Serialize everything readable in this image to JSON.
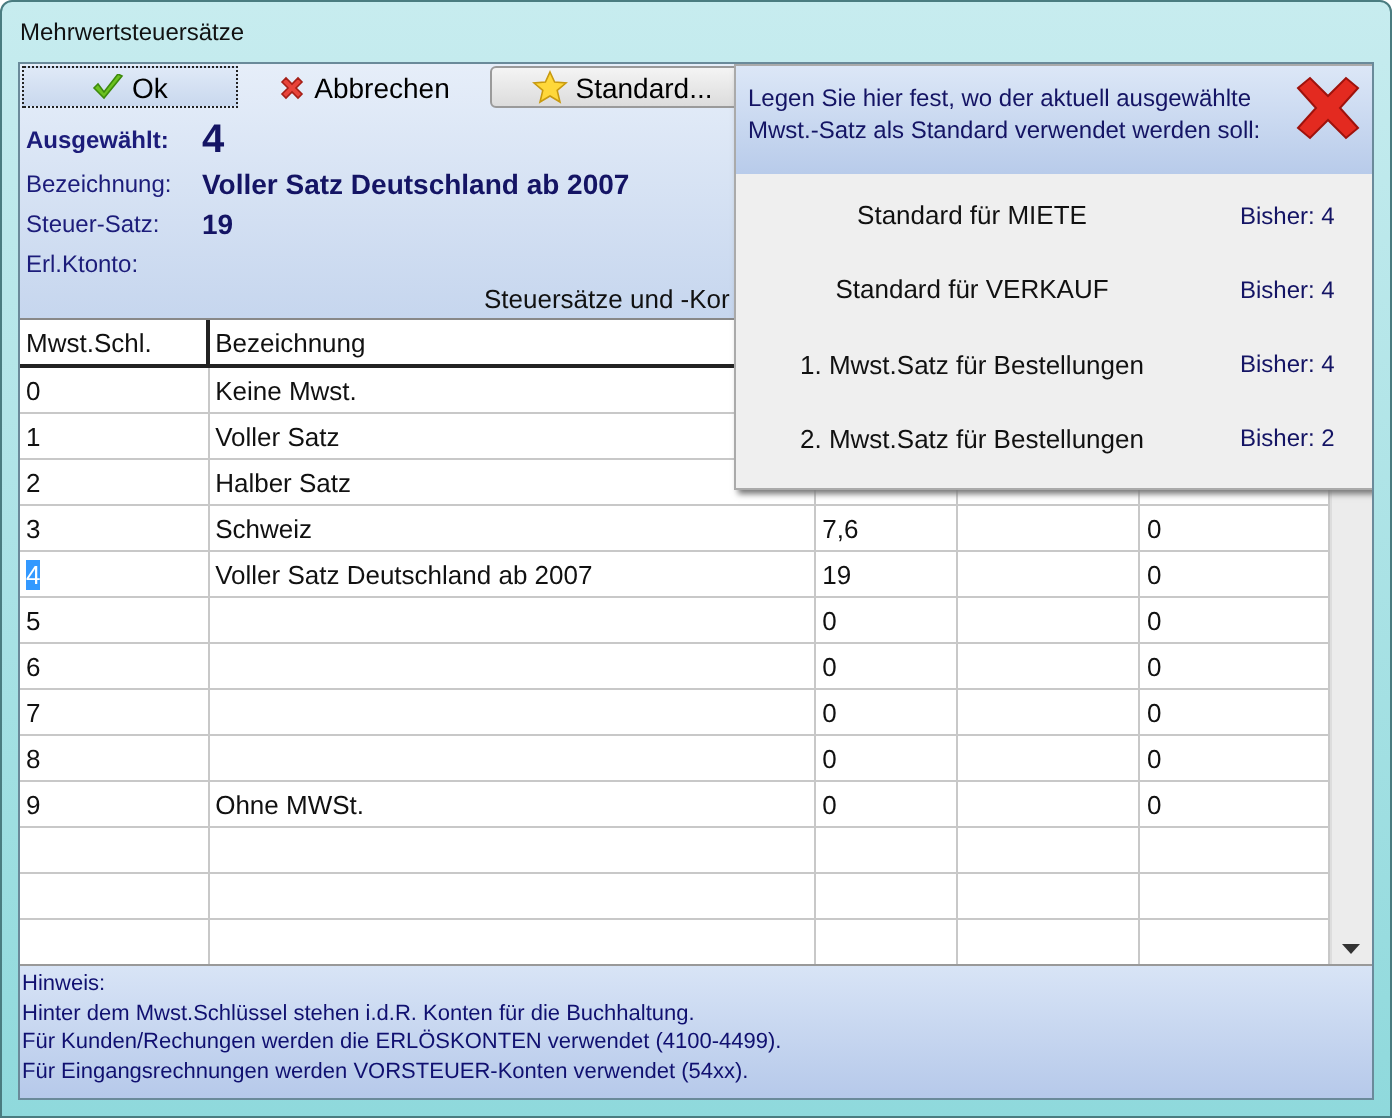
{
  "window": {
    "title": "Mehrwertsteuersätze"
  },
  "toolbar": [
    {
      "kind": "ok",
      "label": "Ok",
      "focused": true
    },
    {
      "kind": "cancel",
      "label": "Abbrechen",
      "focused": false
    },
    {
      "kind": "star",
      "label": "Standard...",
      "focused": false
    }
  ],
  "details": [
    {
      "label": "Ausgewählt:",
      "value": "4",
      "kind": "big"
    },
    {
      "label": "Bezeichnung:",
      "value": "Voller Satz Deutschland ab 2007",
      "kind": "normal"
    },
    {
      "label": "Steuer-Satz:",
      "value": "19",
      "kind": "normal"
    },
    {
      "label": "Erl.Ktonto:",
      "kind": "normal"
    }
  ],
  "table_caption": "Steuersätze und -Kor",
  "table": {
    "columns": [
      "Mwst.Schl.",
      "Bezeichnung"
    ],
    "rows": [
      {
        "cells": [
          "0",
          "Keine Mwst."
        ],
        "selected": false
      },
      {
        "cells": [
          "1",
          "Voller Satz"
        ],
        "selected": false
      },
      {
        "cells": [
          "2",
          "Halber Satz"
        ],
        "selected": false
      },
      {
        "cells": [
          "3",
          "Schweiz",
          "7,6",
          "",
          "0"
        ],
        "selected": false
      },
      {
        "cells": [
          "4",
          "Voller Satz Deutschland ab 2007",
          "19",
          "",
          "0"
        ],
        "selected": true
      },
      {
        "cells": [
          "5",
          "",
          "0",
          "",
          "0"
        ],
        "selected": false
      },
      {
        "cells": [
          "6",
          "",
          "0",
          "",
          "0"
        ],
        "selected": false
      },
      {
        "cells": [
          "7",
          "",
          "0",
          "",
          "0"
        ],
        "selected": false
      },
      {
        "cells": [
          "8",
          "",
          "0",
          "",
          "0"
        ],
        "selected": false
      },
      {
        "cells": [
          "9",
          "Ohne MWSt.",
          "0",
          "",
          "0"
        ],
        "selected": false
      }
    ]
  },
  "hint": [
    "Hinweis:",
    "Hinter dem Mwst.Schlüssel stehen i.d.R. Konten für die Buchhaltung.",
    "Für Kunden/Rechungen werden die ERLÖSKONTEN verwendet (4100-4499).",
    "Für Eingangsrechnungen werden VORSTEUER-Konten verwendet (54xx)."
  ],
  "popup": {
    "message": "Legen Sie hier fest, wo der aktuell ausgewählte Mwst.-Satz als Standard verwendet werden soll:",
    "options": [
      {
        "label": "Standard für MIETE",
        "previous": "Bisher: 4"
      },
      {
        "label": "Standard für VERKAUF",
        "previous": "Bisher: 4"
      },
      {
        "label": "1. Mwst.Satz für Bestellungen",
        "previous": "Bisher: 4"
      },
      {
        "label": "2. Mwst.Satz für Bestellungen",
        "previous": "Bisher: 2"
      }
    ]
  }
}
